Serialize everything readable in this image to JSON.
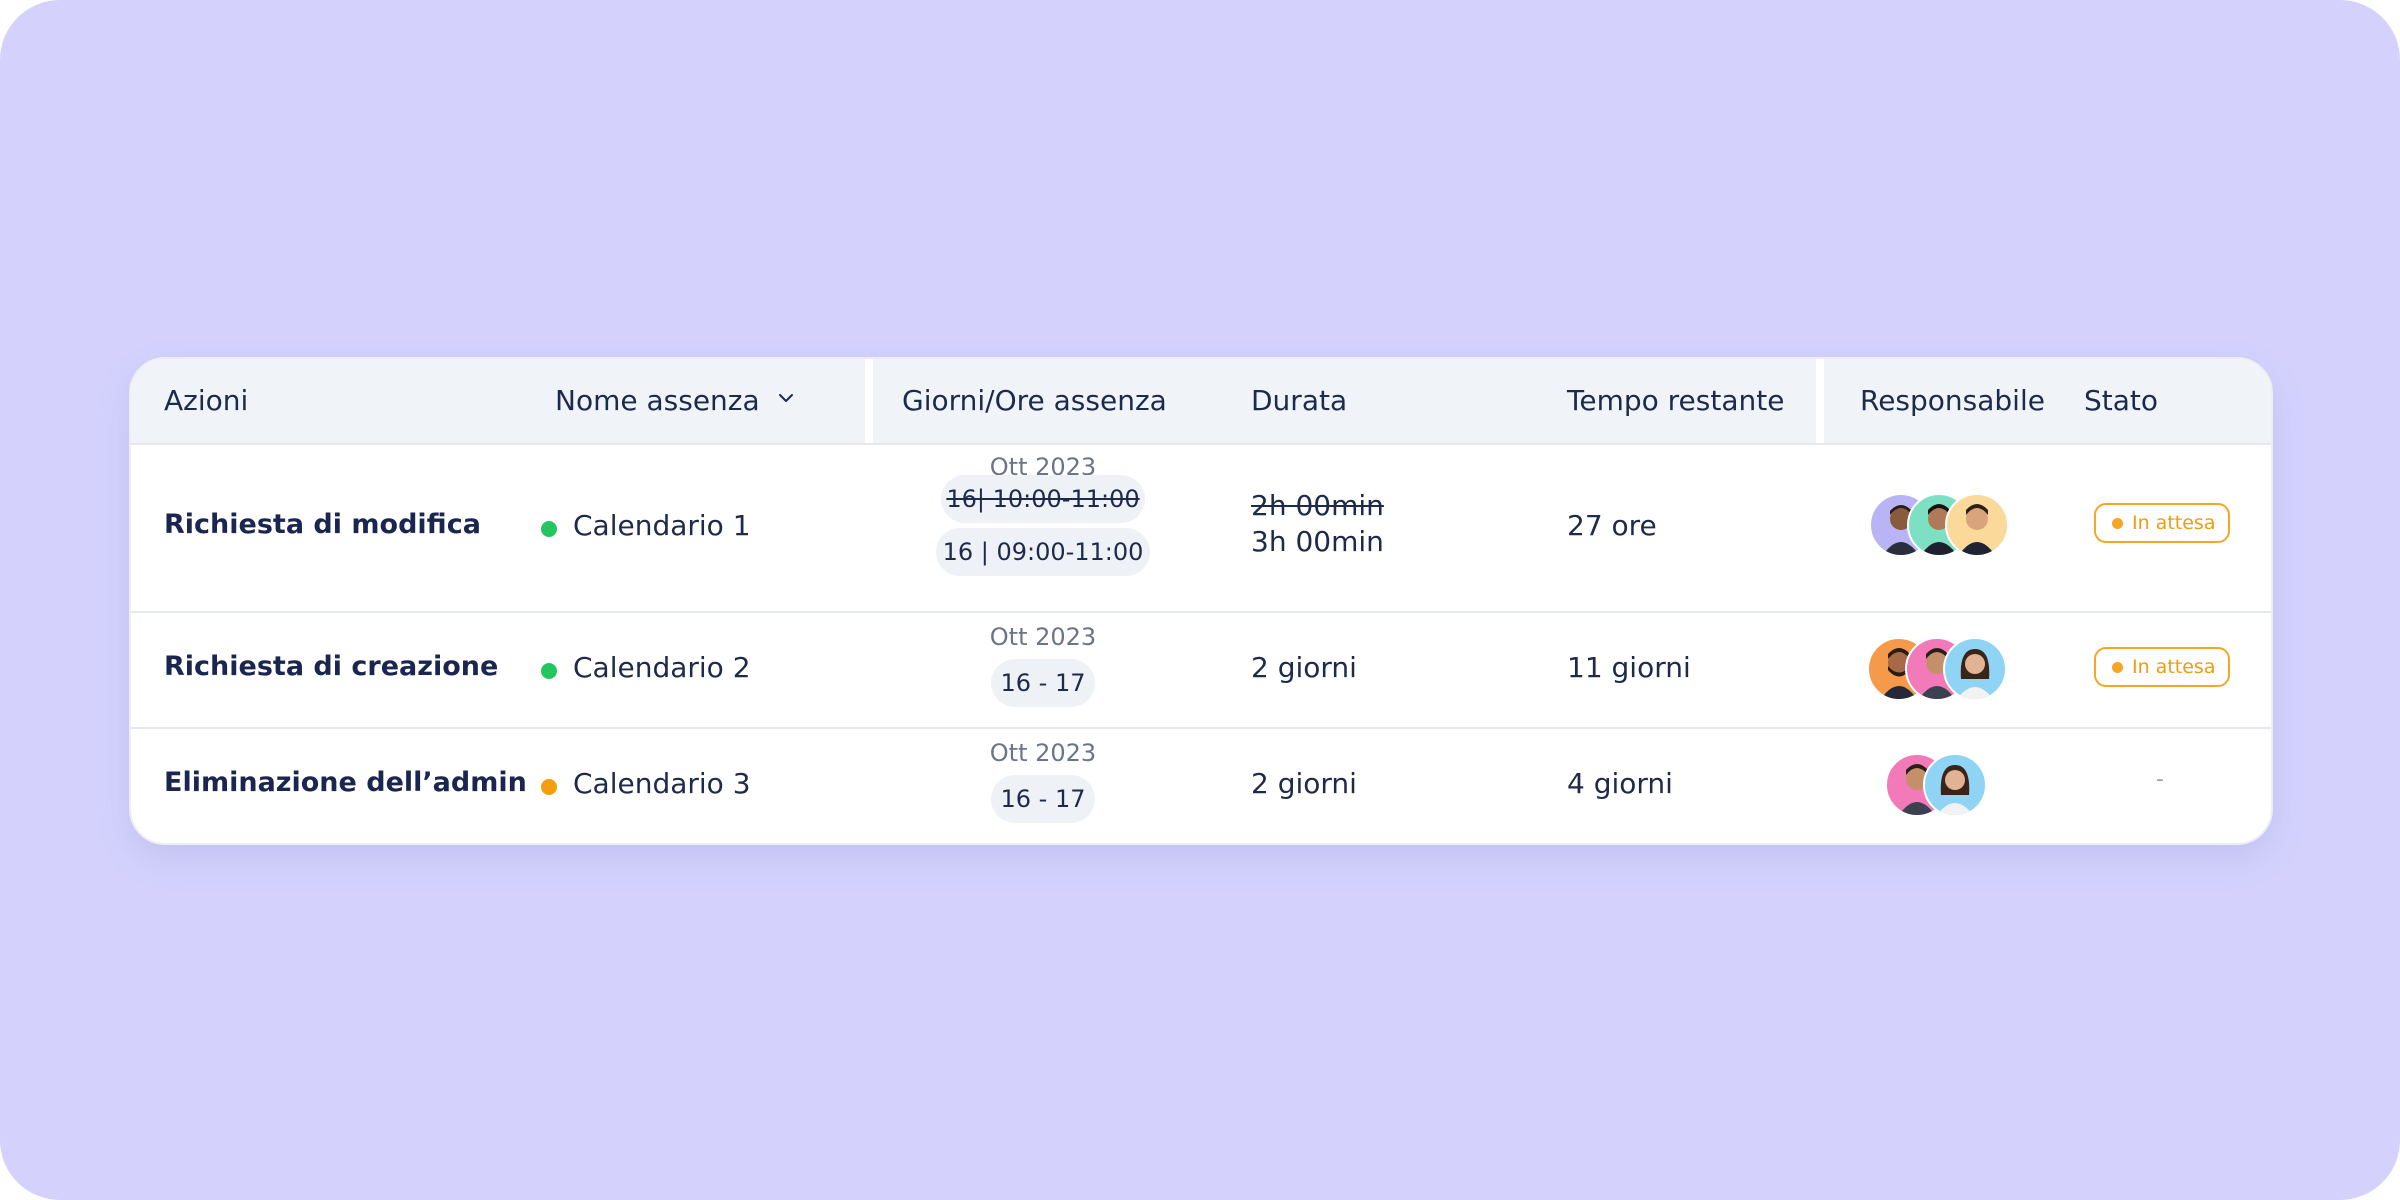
{
  "columns": {
    "actions": "Azioni",
    "absence_name": "Nome assenza",
    "days_hours": "Giorni/Ore assenza",
    "duration": "Durata",
    "remaining": "Tempo restante",
    "owner": "Responsabile",
    "status": "Stato"
  },
  "icons": {
    "sort": "chevron-down-icon",
    "calendar_dot": "status-dot"
  },
  "colors": {
    "background": "#d4d2fd",
    "green": "#22c55e",
    "orange": "#f59e0b",
    "badge": "#f5a623"
  },
  "rows": [
    {
      "action": "Richiesta di modifica",
      "calendar": "Calendario 1",
      "calendar_color": "green",
      "month": "Ott 2023",
      "old_period": "16| 10:00-11:00",
      "period": "16 | 09:00-11:00",
      "old_duration": "2h 00min",
      "duration": "3h 00min",
      "remaining": "27 ore",
      "owners": [
        "person-1",
        "person-2",
        "person-3"
      ],
      "status": "In attesa"
    },
    {
      "action": "Richiesta di creazione",
      "calendar": "Calendario 2",
      "calendar_color": "green",
      "month": "Ott 2023",
      "period": "16 - 17",
      "duration": "2 giorni",
      "remaining": "11 giorni",
      "owners": [
        "person-4",
        "person-5",
        "person-6"
      ],
      "status": "In attesa"
    },
    {
      "action": "Eliminazione dell’admin",
      "calendar": "Calendario 3",
      "calendar_color": "orange",
      "month": "Ott 2023",
      "period": "16 - 17",
      "duration": "2 giorni",
      "remaining": "4 giorni",
      "owners": [
        "person-7",
        "person-8"
      ],
      "status": "-"
    }
  ]
}
